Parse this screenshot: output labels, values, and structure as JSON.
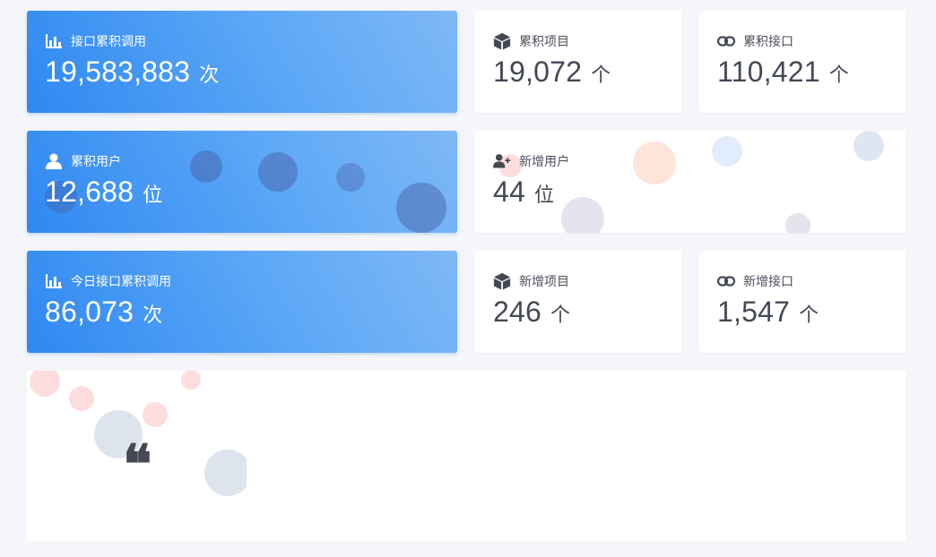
{
  "stats": {
    "total_calls": {
      "label": "接口累积调用",
      "value": "19,583,883",
      "unit": "次",
      "icon": "bar-chart-icon"
    },
    "total_projects": {
      "label": "累积项目",
      "value": "19,072",
      "unit": "个",
      "icon": "cube-icon"
    },
    "total_apis": {
      "label": "累积接口",
      "value": "110,421",
      "unit": "个",
      "icon": "link-icon"
    },
    "total_users": {
      "label": "累积用户",
      "value": "12,688",
      "unit": "位",
      "icon": "user-icon"
    },
    "new_users": {
      "label": "新增用户",
      "value": "44",
      "unit": "位",
      "icon": "user-plus-icon"
    },
    "today_calls": {
      "label": "今日接口累积调用",
      "value": "86,073",
      "unit": "次",
      "icon": "bar-chart-icon"
    },
    "new_projects": {
      "label": "新增项目",
      "value": "246",
      "unit": "个",
      "icon": "cube-icon"
    },
    "new_apis": {
      "label": "新增接口",
      "value": "1,547",
      "unit": "个",
      "icon": "link-icon"
    }
  },
  "quote": {
    "mark": "❝",
    "icon": "quote-icon"
  },
  "colors": {
    "accent_start": "#2f88f1",
    "accent_end": "#7fb8f6",
    "page_bg": "#f5f6fa",
    "text_dark": "#434955"
  }
}
